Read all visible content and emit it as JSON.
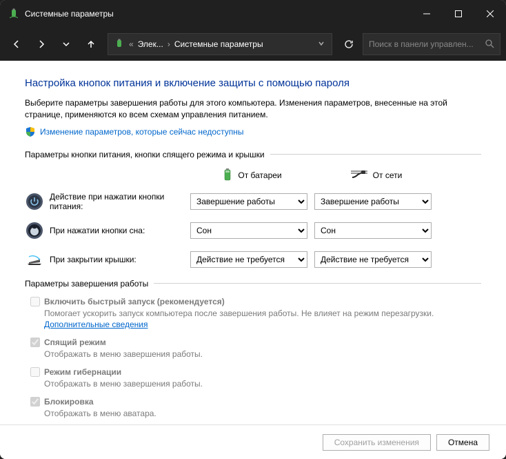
{
  "window": {
    "title": "Системные параметры"
  },
  "breadcrumb": {
    "item1": "Элек...",
    "item2": "Системные параметры"
  },
  "search": {
    "placeholder": "Поиск в панели управлен..."
  },
  "page": {
    "heading": "Настройка кнопок питания и включение защиты с помощью пароля",
    "description": "Выберите параметры завершения работы для этого компьютера. Изменения параметров, внесенные на этой странице, применяются ко всем схемам управления питанием.",
    "shield_link": "Изменение параметров, которые сейчас недоступны"
  },
  "group1": {
    "label": "Параметры кнопки питания, кнопки спящего режима и крышки",
    "col_battery": "От батареи",
    "col_ac": "От сети",
    "rows": [
      {
        "label": "Действие при нажатии кнопки питания:",
        "battery": "Завершение работы",
        "ac": "Завершение работы"
      },
      {
        "label": "При нажатии кнопки сна:",
        "battery": "Сон",
        "ac": "Сон"
      },
      {
        "label": "При закрытии крышки:",
        "battery": "Действие не требуется",
        "ac": "Действие не требуется"
      }
    ]
  },
  "group2": {
    "label": "Параметры завершения работы",
    "items": [
      {
        "label": "Включить быстрый запуск (рекомендуется)",
        "desc": "Помогает ускорить запуск компьютера после завершения работы. Не влияет на режим перезагрузки. ",
        "link": "Дополнительные сведения"
      },
      {
        "label": "Спящий режим",
        "desc": "Отображать в меню завершения работы."
      },
      {
        "label": "Режим гибернации",
        "desc": "Отображать в меню завершения работы."
      },
      {
        "label": "Блокировка",
        "desc": "Отображать в меню аватара."
      }
    ]
  },
  "footer": {
    "save": "Сохранить изменения",
    "cancel": "Отмена"
  }
}
